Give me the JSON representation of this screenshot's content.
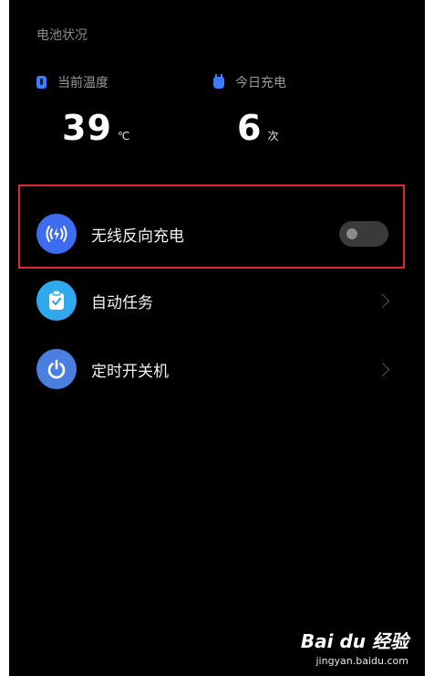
{
  "battery_status": {
    "section_title": "电池状况",
    "temperature": {
      "label": "当前温度",
      "value": "39",
      "unit": "℃"
    },
    "charge_count": {
      "label": "今日充电",
      "value": "6",
      "unit": "次"
    }
  },
  "settings": {
    "items": [
      {
        "label": "无线反向充电",
        "icon": "wireless-charging-icon",
        "icon_color": "#3d6cf0",
        "control": "toggle",
        "enabled": false
      },
      {
        "label": "自动任务",
        "icon": "clipboard-check-icon",
        "icon_color": "#2fa8ee",
        "control": "chevron"
      },
      {
        "label": "定时开关机",
        "icon": "power-icon",
        "icon_color": "#4a7fe0",
        "control": "chevron"
      }
    ]
  },
  "watermark": {
    "brand": "Bai du 经验",
    "domain": "jingyan.baidu.com"
  },
  "colors": {
    "background": "#000000",
    "accent": "#3d7bff",
    "highlight_border": "#e02a2a"
  }
}
